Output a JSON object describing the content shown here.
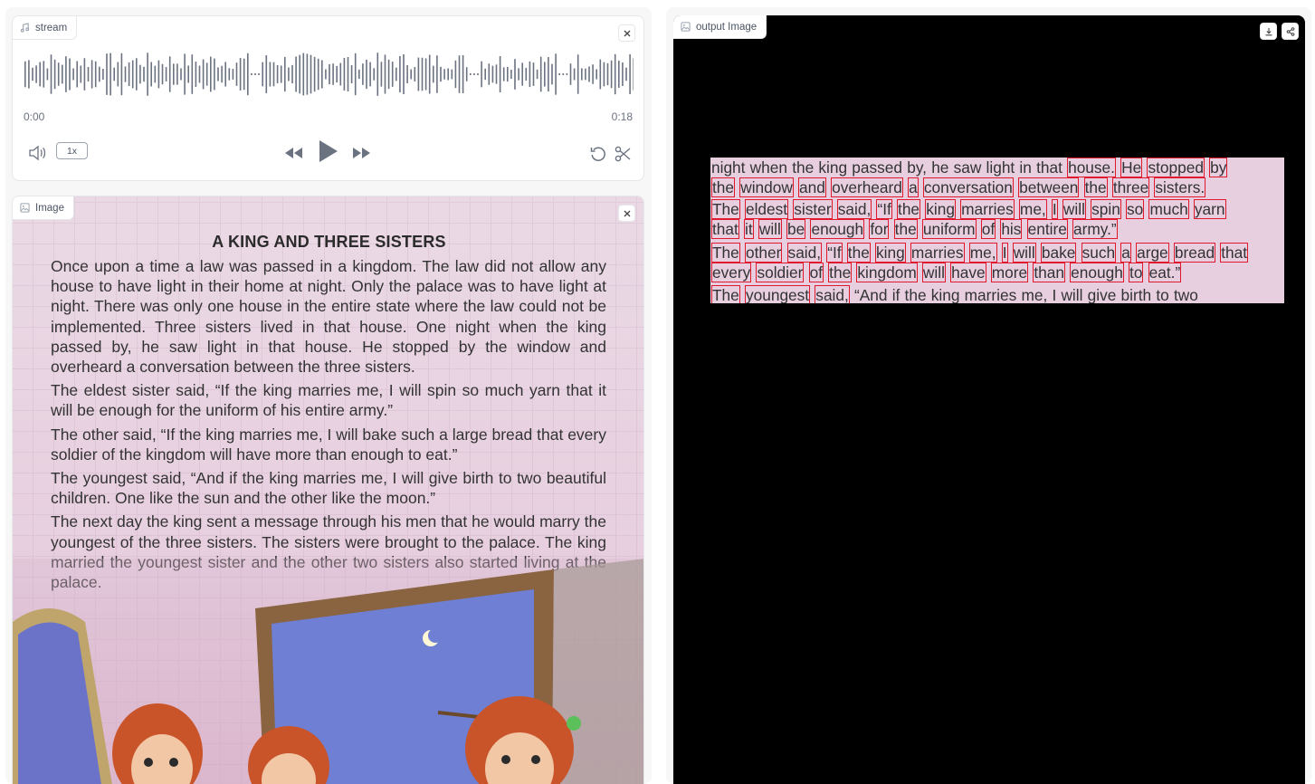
{
  "audio": {
    "label": "stream",
    "time_start": "0:00",
    "time_end": "0:18",
    "rate": "1x"
  },
  "image_input": {
    "label": "Image",
    "title": "A KING AND THREE SISTERS",
    "paragraphs": [
      "Once upon a time a law was passed in a kingdom. The law did not allow any house to have light in their home at night. Only the palace was to have light at night. There was only one house in the entire state where the law could not be implemented. Three sisters lived in that house. One night when the king passed by, he saw light in that house. He stopped by the window and overheard a conversation between the three sisters.",
      "The eldest sister said, “If the king marries me, I will spin so much yarn that it will be enough for the uniform of his entire army.”",
      "The other said, “If the king marries me, I will bake such a large bread that every soldier of the kingdom will have more than enough to eat.”",
      "The youngest said, “And if the king marries me, I will give birth to two beautiful children. One like the sun and the other like the moon.”",
      "The next day the king sent a message through his men that he would marry the youngest of the three sisters. The sisters were brought to the palace. The king married the youngest sister and the other two sisters also started living at the palace."
    ]
  },
  "output": {
    "label": "output Image",
    "lines": [
      [
        [
          "night",
          0
        ],
        [
          "when",
          0
        ],
        [
          "the",
          0
        ],
        [
          "king",
          0
        ],
        [
          "passed",
          0
        ],
        [
          "by,",
          0
        ],
        [
          "he",
          0
        ],
        [
          "saw",
          0
        ],
        [
          "light",
          0
        ],
        [
          "in",
          0
        ],
        [
          "that",
          0
        ],
        [
          "house.",
          1
        ],
        [
          "He",
          1
        ],
        [
          "stopped",
          1
        ],
        [
          "by",
          1
        ]
      ],
      [
        [
          "the",
          1
        ],
        [
          "window",
          1
        ],
        [
          "and",
          1
        ],
        [
          "overheard",
          1
        ],
        [
          "a",
          1
        ],
        [
          "conversation",
          1
        ],
        [
          "between",
          1
        ],
        [
          "the",
          1
        ],
        [
          "three",
          1
        ],
        [
          "sisters.",
          1
        ]
      ],
      [
        [
          "The",
          1
        ],
        [
          "eldest",
          1
        ],
        [
          "sister",
          1
        ],
        [
          "said,",
          1
        ],
        [
          "“If",
          1
        ],
        [
          "the",
          1
        ],
        [
          "king",
          1
        ],
        [
          "marries",
          1
        ],
        [
          "me,",
          1
        ],
        [
          "I",
          1
        ],
        [
          "will",
          1
        ],
        [
          "spin",
          1
        ],
        [
          "so",
          1
        ],
        [
          "much",
          1
        ],
        [
          "yarn",
          1
        ]
      ],
      [
        [
          "that",
          1
        ],
        [
          "it",
          1
        ],
        [
          "will",
          1
        ],
        [
          "be",
          1
        ],
        [
          "enough",
          1
        ],
        [
          "for",
          1
        ],
        [
          "the",
          1
        ],
        [
          "uniform",
          1
        ],
        [
          "of",
          1
        ],
        [
          "his",
          1
        ],
        [
          "entire",
          1
        ],
        [
          "army.”",
          1
        ]
      ],
      [
        [
          "The",
          1
        ],
        [
          "other",
          1
        ],
        [
          "said,",
          1
        ],
        [
          "“If",
          1
        ],
        [
          "the",
          1
        ],
        [
          "king",
          1
        ],
        [
          "marries",
          1
        ],
        [
          "me,",
          1
        ],
        [
          "I",
          1
        ],
        [
          "will",
          1
        ],
        [
          "bake",
          1
        ],
        [
          "such",
          1
        ],
        [
          "a",
          1
        ],
        [
          "arge",
          1
        ],
        [
          "bread",
          1
        ],
        [
          "that",
          1
        ]
      ],
      [
        [
          "every",
          1
        ],
        [
          "soldier",
          1
        ],
        [
          "of",
          1
        ],
        [
          "the",
          1
        ],
        [
          "kingdom",
          1
        ],
        [
          "will",
          1
        ],
        [
          "have",
          1
        ],
        [
          "more",
          1
        ],
        [
          "than",
          1
        ],
        [
          "enough",
          1
        ],
        [
          "to",
          1
        ],
        [
          "eat.”",
          1
        ]
      ],
      [
        [
          "The",
          1
        ],
        [
          "youngest",
          1
        ],
        [
          "said,",
          1
        ],
        [
          "“And",
          0
        ],
        [
          "if",
          0
        ],
        [
          "the",
          0
        ],
        [
          "king",
          0
        ],
        [
          "marries",
          0
        ],
        [
          "me,",
          0
        ],
        [
          "I",
          0
        ],
        [
          "will",
          0
        ],
        [
          "give",
          0
        ],
        [
          "birth",
          0
        ],
        [
          "to",
          0
        ],
        [
          "two",
          0
        ]
      ]
    ]
  },
  "colors": {
    "box": "#e01a2e",
    "page": "#e7cfdf"
  }
}
